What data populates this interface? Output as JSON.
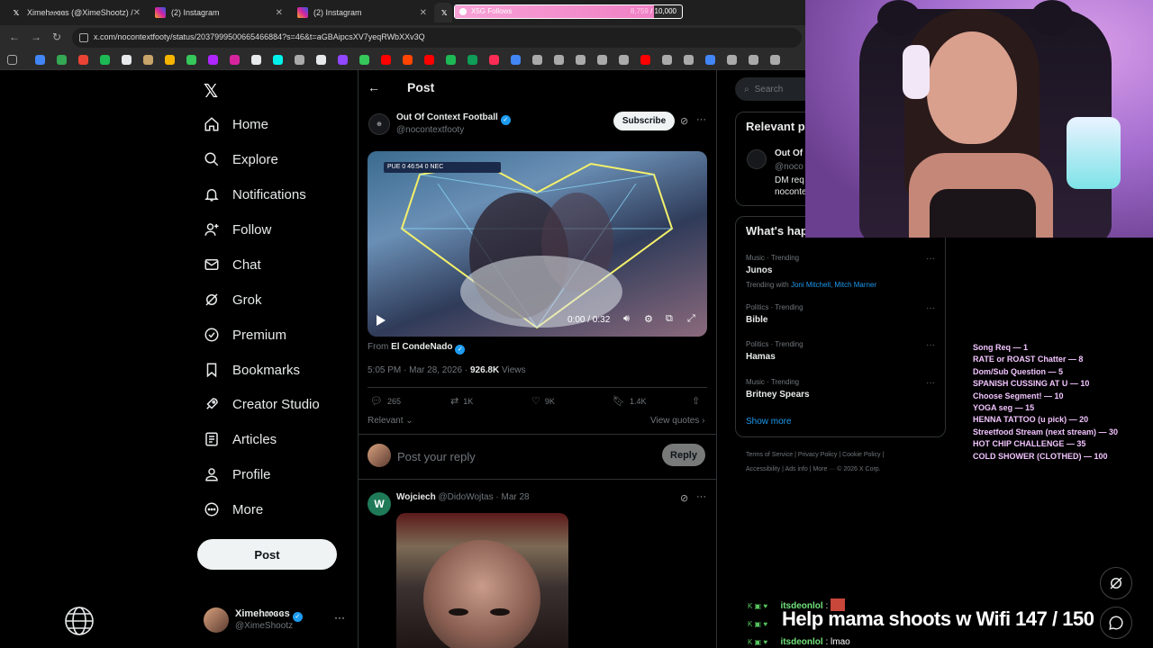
{
  "browser": {
    "tabs": [
      {
        "title": "Ximeh𝔬𝔬ɞɞs (@XimeShootz) /",
        "favicon": "x-icon"
      },
      {
        "title": "(2) Instagram",
        "favicon": "instagram-icon"
      },
      {
        "title": "(2) Instagram",
        "favicon": "instagram-icon"
      },
      {
        "title": "",
        "favicon": "x-icon"
      }
    ],
    "url": "x.com/nocontextfooty/status/2037999500665466884?s=46&t=aGBAipcsXV7yeqRWbXXv3Q"
  },
  "goal": {
    "label": "X5G Follows",
    "current": "8,759",
    "target": "10,000",
    "progress": 0.8759
  },
  "sidebar": {
    "items": [
      {
        "label": "Home",
        "icon": "home-icon"
      },
      {
        "label": "Explore",
        "icon": "search-icon"
      },
      {
        "label": "Notifications",
        "icon": "bell-icon"
      },
      {
        "label": "Follow",
        "icon": "add-person-icon"
      },
      {
        "label": "Chat",
        "icon": "mail-icon"
      },
      {
        "label": "Grok",
        "icon": "grok-icon"
      },
      {
        "label": "Premium",
        "icon": "verified-icon"
      },
      {
        "label": "Bookmarks",
        "icon": "bookmark-icon"
      },
      {
        "label": "Creator Studio",
        "icon": "rocket-icon"
      },
      {
        "label": "Articles",
        "icon": "article-icon"
      },
      {
        "label": "Profile",
        "icon": "person-icon"
      },
      {
        "label": "More",
        "icon": "more-circle-icon"
      }
    ],
    "post_button": "Post",
    "account": {
      "name": "Ximeh𝔬𝔬ɞɞs",
      "handle": "@XimeShootz"
    }
  },
  "post": {
    "header_title": "Post",
    "author": {
      "name": "Out Of Context Football",
      "handle": "@nocontextfooty",
      "subscribe": "Subscribe"
    },
    "video": {
      "time": "0:00 / 0:32",
      "scorebug": "PUE 0  46:54  0 NEC"
    },
    "from_label": "From",
    "from_name": "El CondeNado",
    "timestamp": "5:05 PM · Mar 28, 2026 · ",
    "views_count": "926.8K",
    "views_label": " Views",
    "stats": {
      "replies": "265",
      "reposts": "1K",
      "likes": "9K",
      "bookmarks": "1.4K"
    },
    "sort_label": "Relevant",
    "view_quotes": "View quotes",
    "reply_placeholder": "Post your reply",
    "reply_button": "Reply"
  },
  "comment": {
    "avatar_letter": "W",
    "name": "Wojciech",
    "handle": "@DidoWojtas",
    "date": "· Mar 28"
  },
  "right": {
    "search_placeholder": "Search",
    "relevant_title": "Relevant p",
    "relevant_person": {
      "name": "Out Of",
      "handle": "@noco",
      "bio1": "DM req",
      "bio2": "noconte"
    },
    "happening_title": "What's hap",
    "trends": [
      {
        "category": "Music · Trending",
        "name": "Junos",
        "with_label": "Trending with ",
        "with": "Joni Mitchell, Mitch Marner"
      },
      {
        "category": "Politics · Trending",
        "name": "Bible"
      },
      {
        "category": "Politics · Trending",
        "name": "Hamas"
      },
      {
        "category": "Music · Trending",
        "name": "Britney Spears"
      }
    ],
    "show_more": "Show more",
    "footer_line1": "Terms of Service  |  Privacy Policy  |  Cookie Policy  |",
    "footer_line2": "Accessibility  |  Ads info  |  More ···  © 2026 X Corp."
  },
  "overlay": {
    "menu": [
      "Song Req — 1",
      "RATE or ROAST Chatter — 8",
      "Dom/Sub Question — 5",
      "SPANISH CUSSING AT U — 10",
      "Choose Segment! — 10",
      "YOGA seg — 15",
      "HENNA TATTOO (u pick) — 20",
      "Streetfood Stream (next stream) — 30",
      "HOT CHIP CHALLENGE — 35",
      "COLD SHOWER (CLOTHED) — 100"
    ],
    "chat": [
      {
        "user": "itsdeonlol",
        "message": ""
      },
      {
        "user": "",
        "message": ""
      },
      {
        "user": "itsdeonlol",
        "message": "lmao"
      }
    ],
    "banner": "Help mama shoots w Wifi  147 / 150"
  }
}
